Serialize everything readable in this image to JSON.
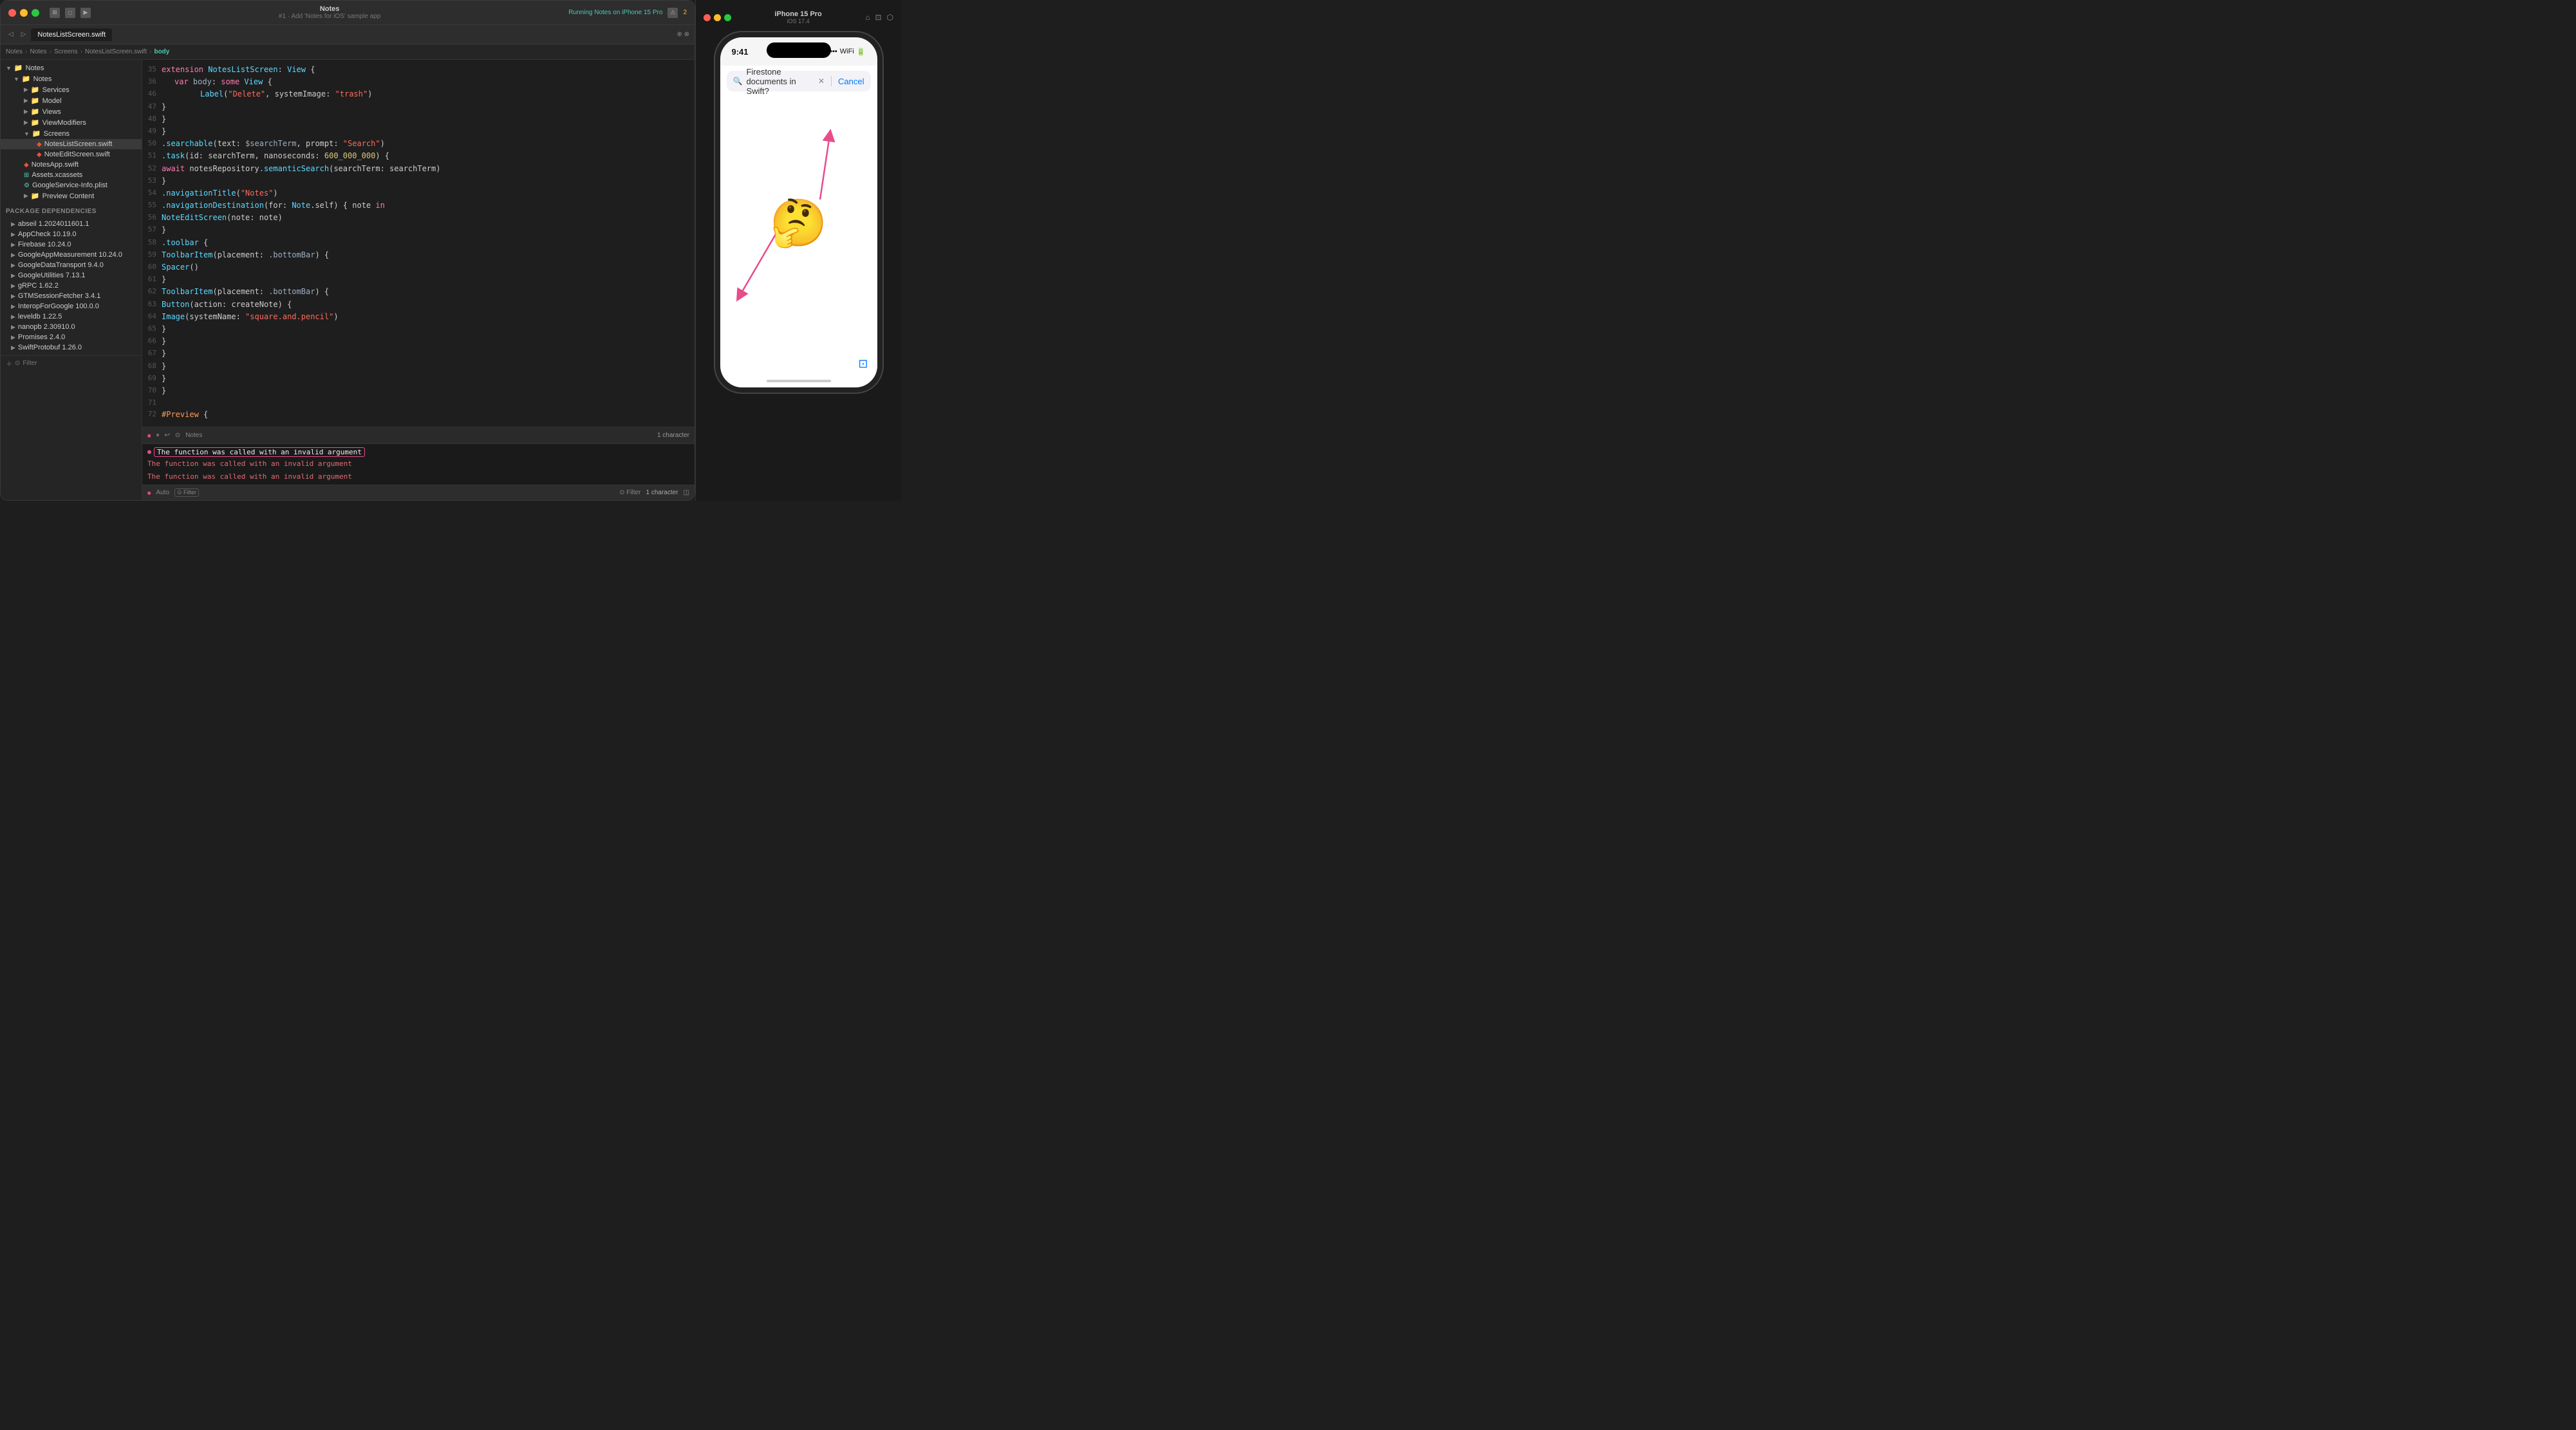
{
  "titleBar": {
    "title": "Notes",
    "subtitle": "#1 · Add 'Notes for iOS' sample app",
    "runStatus": "Running Notes on iPhone 15 Pro",
    "warningCount": "2",
    "tab": "NotesListScreen.swift"
  },
  "breadcrumb": {
    "items": [
      "Notes",
      "Notes",
      "Screens",
      "NotesListScreen.swift",
      "body"
    ]
  },
  "sidebar": {
    "rootLabel": "Notes",
    "items": [
      {
        "label": "Notes",
        "type": "group",
        "indent": 0
      },
      {
        "label": "Services",
        "type": "folder",
        "indent": 1
      },
      {
        "label": "Model",
        "type": "folder",
        "indent": 1
      },
      {
        "label": "Views",
        "type": "folder",
        "indent": 1
      },
      {
        "label": "ViewModifiers",
        "type": "folder",
        "indent": 1
      },
      {
        "label": "Screens",
        "type": "folder",
        "indent": 1,
        "expanded": true
      },
      {
        "label": "NotesListScreen.swift",
        "type": "swift",
        "indent": 2,
        "active": true
      },
      {
        "label": "NoteEditScreen.swift",
        "type": "swift",
        "indent": 2
      },
      {
        "label": "NotesApp.swift",
        "type": "swift",
        "indent": 1
      },
      {
        "label": "Assets.xcassets",
        "type": "assets",
        "indent": 1
      },
      {
        "label": "GoogleService-Info.plist",
        "type": "plist",
        "indent": 1
      },
      {
        "label": "Preview Content",
        "type": "folder",
        "indent": 1
      }
    ],
    "packageDepsLabel": "Package Dependencies",
    "packages": [
      {
        "label": "abseil 1.2024011601.1"
      },
      {
        "label": "AppCheck 10.19.0"
      },
      {
        "label": "Firebase 10.24.0"
      },
      {
        "label": "GoogleAppMeasurement 10.24.0"
      },
      {
        "label": "GoogleDataTransport 9.4.0"
      },
      {
        "label": "GoogleUtilities 7.13.1"
      },
      {
        "label": "gRPC 1.62.2"
      },
      {
        "label": "GTMSessionFetcher 3.4.1"
      },
      {
        "label": "InteropForGoogle 100.0.0"
      },
      {
        "label": "leveldb 1.22.5"
      },
      {
        "label": "nanopb 2.30910.0"
      },
      {
        "label": "Promises 2.4.0"
      },
      {
        "label": "SwiftProtobuf 1.26.0"
      }
    ]
  },
  "codeLines": [
    {
      "num": 35,
      "content": "extension NotesListScreen: View {"
    },
    {
      "num": 36,
      "content": "    var body: some View {"
    },
    {
      "num": 46,
      "content": "                Label(\"Delete\", systemImage: \"trash\")"
    },
    {
      "num": 47,
      "content": "            }"
    },
    {
      "num": 48,
      "content": "        }"
    },
    {
      "num": 49,
      "content": "    }"
    },
    {
      "num": 50,
      "content": "        .searchable(text: $searchTerm, prompt: \"Search\")"
    },
    {
      "num": 51,
      "content": "        .task(id: searchTerm, nanoseconds: 600_000_000) {"
    },
    {
      "num": 52,
      "content": "            await notesRepository.semanticSearch(searchTerm: searchTerm)"
    },
    {
      "num": 53,
      "content": "        }"
    },
    {
      "num": 54,
      "content": "        .navigationTitle(\"Notes\")"
    },
    {
      "num": 55,
      "content": "        .navigationDestination(for: Note.self) { note in"
    },
    {
      "num": 56,
      "content": "            NoteEditScreen(note: note)"
    },
    {
      "num": 57,
      "content": "        }"
    },
    {
      "num": 58,
      "content": "        .toolbar {"
    },
    {
      "num": 59,
      "content": "            ToolbarItem(placement: .bottomBar) {"
    },
    {
      "num": 60,
      "content": "                Spacer()"
    },
    {
      "num": 61,
      "content": "            }"
    },
    {
      "num": 62,
      "content": "            ToolbarItem(placement: .bottomBar) {"
    },
    {
      "num": 63,
      "content": "                Button(action: createNote) {"
    },
    {
      "num": 64,
      "content": "                    Image(systemName: \"square.and.pencil\")"
    },
    {
      "num": 65,
      "content": "                }"
    },
    {
      "num": 66,
      "content": "            }"
    },
    {
      "num": 67,
      "content": "        }"
    },
    {
      "num": 68,
      "content": "    }"
    },
    {
      "num": 69,
      "content": "}"
    },
    {
      "num": 70,
      "content": "}"
    },
    {
      "num": 71,
      "content": ""
    },
    {
      "num": 72,
      "content": "#Preview {"
    }
  ],
  "console": {
    "errorMessages": [
      {
        "text": "The function was called with an invalid argument",
        "highlighted": true
      },
      {
        "text": "The function was called with an invalid argument",
        "highlighted": false
      },
      {
        "text": "The function was called with an invalid argument",
        "highlighted": false
      }
    ],
    "characterCount": "1 character"
  },
  "statusBar": {
    "leftItems": [
      "Auto",
      "Filter"
    ],
    "rightItems": [
      "Filter",
      "1 character"
    ]
  },
  "iphone": {
    "title": "iPhone 15 Pro",
    "subtitle": "iOS 17.4",
    "time": "9:41",
    "searchPlaceholder": "Firestone documents in Swift?",
    "cancelLabel": "Cancel",
    "thinkingEmoji": "🤔",
    "composeIcon": "✎"
  }
}
